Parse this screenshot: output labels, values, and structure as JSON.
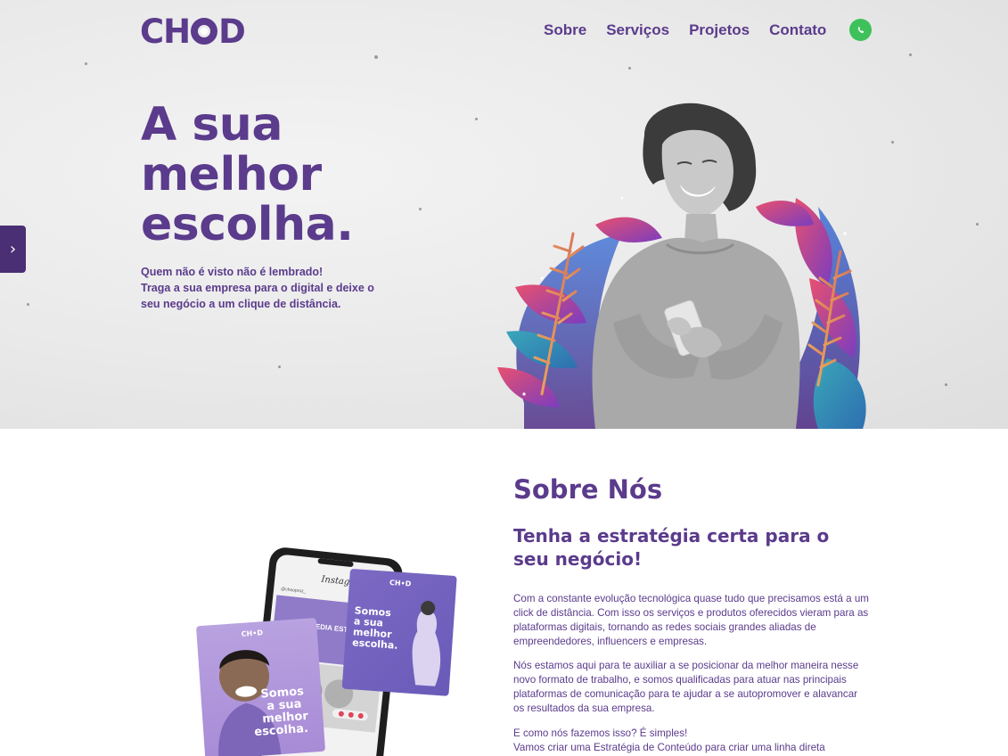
{
  "brand": {
    "logo_text_left": "CH",
    "logo_text_right": "D"
  },
  "nav": {
    "items": [
      {
        "label": "Sobre"
      },
      {
        "label": "Serviços"
      },
      {
        "label": "Projetos"
      },
      {
        "label": "Contato"
      }
    ],
    "whatsapp_icon": "whatsapp-icon"
  },
  "side_tab": {
    "icon": "chevron-right-icon",
    "glyph": "›"
  },
  "hero": {
    "title_lines": [
      "A sua",
      "melhor",
      "escolha."
    ],
    "subtitle_lines": [
      "Quem não é visto não é lembrado!",
      "Traga a sua empresa para o digital e deixe o",
      "seu negócio a um clique de distância."
    ]
  },
  "about": {
    "title": "Sobre Nós",
    "subtitle": "Tenha a estratégia certa para o seu negócio!",
    "paragraph_1": "Com a constante evolução tecnológica quase tudo que precisamos está a um click de distância. Com isso os serviços e produtos oferecidos vieram para as plataformas digitais, tornando as redes sociais grandes aliadas de empreendedores, influencers e empresas.",
    "paragraph_2": "Nós estamos aqui para te auxiliar a se posicionar da melhor maneira nesse novo formato de trabalho, e somos qualificadas para atuar nas principais plataformas de comunicação para te ajudar a se autopromover e alavancar os resultados da sua empresa.",
    "paragraph_3_line_1": "E como nós fazemos isso? É simples!",
    "paragraph_3_line_2": "Vamos criar uma Estratégia de Conteúdo para criar uma linha direta"
  },
  "mockup": {
    "phone_app": "Instagram",
    "phone_handle": "@chooproz_",
    "phone_banner": "SOCIAL MEDIA ESTRATÉGICA",
    "card_left_logo": "CH•D",
    "card_left_text": [
      "Somos",
      "a sua",
      "melhor",
      "escolha."
    ],
    "card_right_logo": "CH•D",
    "card_right_text": [
      "Somos",
      "a sua",
      "melhor",
      "escolha."
    ]
  },
  "colors": {
    "brand_purple": "#5b3b8c",
    "whatsapp_green": "#3ec15b",
    "side_tab": "#4a2f74"
  }
}
